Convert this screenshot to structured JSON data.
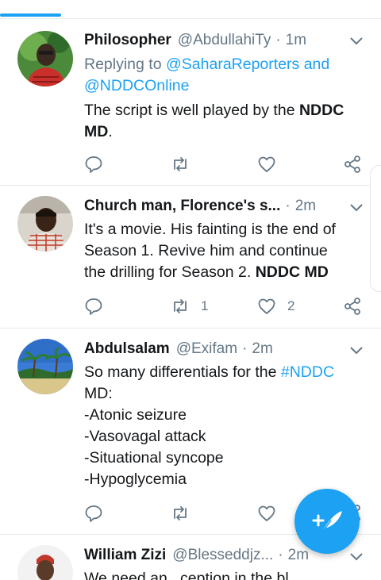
{
  "tweets": [
    {
      "name": "Philosopher",
      "handle": "@AbdullahiTy",
      "time": "1m",
      "reply_prefix": "Replying to",
      "reply_mentions_1": "@SaharaReporters and",
      "reply_mentions_2": "@NDDCOnline",
      "text_line1_a": "The script is well played by the ",
      "text_line1_b": "NDDC",
      "text_line2_a": "MD",
      "text_line2_b": ".",
      "retweets": "",
      "likes": ""
    },
    {
      "name": "Church man, Florence's s...",
      "handle": "",
      "time": "2m",
      "lines": [
        "It's a movie. His fainting is the end of",
        "Season 1. Revive him and continue",
        "the drilling for Season 2. "
      ],
      "bold_tail": "NDDC MD",
      "retweets": "1",
      "likes": "2"
    },
    {
      "name": "Abdulsalam",
      "handle": "@Exifam",
      "time": "2m",
      "line1_a": "So many differentials for the ",
      "hashtag": "#NDDC",
      "lines": [
        "MD:",
        "-Atonic seizure",
        "-Vasovagal attack",
        "-Situational syncope",
        "-Hypoglycemia"
      ],
      "retweets": "",
      "likes": ""
    },
    {
      "name": "William Zizi",
      "handle": "@Blesseddjz...",
      "time": "2m",
      "partial_text": "We need an...ception in the bl..."
    }
  ],
  "icons": {
    "reply": "reply-icon",
    "retweet": "retweet-icon",
    "like": "heart-icon",
    "share": "share-icon",
    "chevron": "chevron-down-icon",
    "compose": "compose-tweet-icon"
  },
  "colors": {
    "accent": "#1da1f2",
    "muted": "#657786",
    "text": "#14171a"
  }
}
